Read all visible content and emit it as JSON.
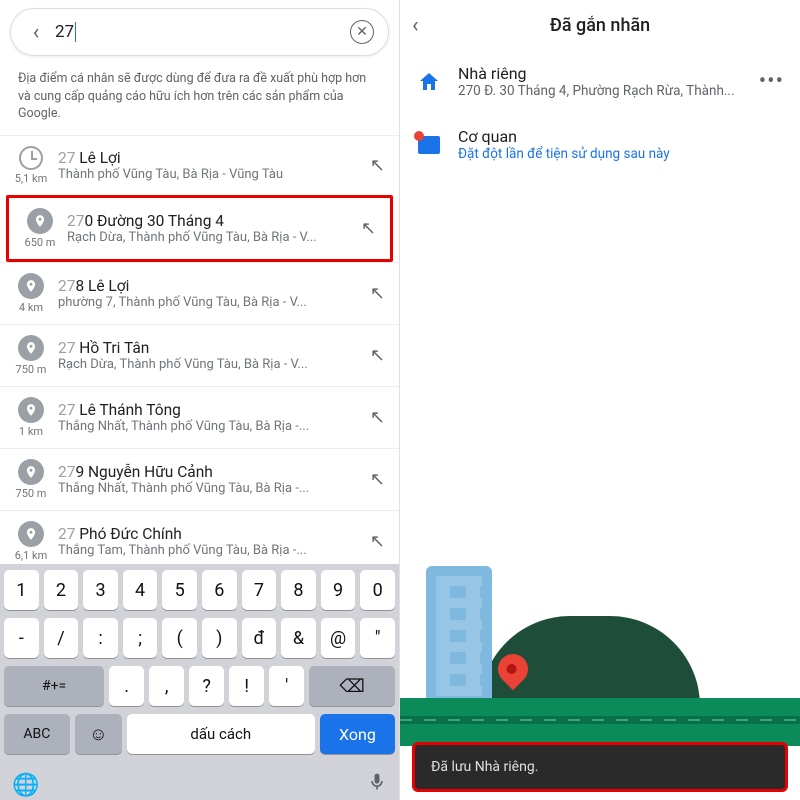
{
  "left": {
    "search_value": "27",
    "note": "Địa điểm cá nhân sẽ được dùng để đưa ra đề xuất phù hợp hơn và cung cấp quảng cáo hữu ích hơn trên các sản phẩm của Google.",
    "results": [
      {
        "icon": "clock",
        "distance": "5,1 km",
        "match": "27",
        "rest": " Lê Lợi",
        "sub": "Thành phố Vũng Tàu, Bà Rịa - Vũng Tàu",
        "highlight": false
      },
      {
        "icon": "pin",
        "distance": "650 m",
        "match": "27",
        "rest": "0 Đường 30 Tháng 4",
        "sub": "Rạch Dừa, Thành phố Vũng Tàu, Bà Rịa - V...",
        "highlight": true
      },
      {
        "icon": "pin",
        "distance": "4 km",
        "match": "27",
        "rest": "8 Lê Lợi",
        "sub": "phường 7, Thành phố Vũng Tàu, Bà Rịa - V...",
        "highlight": false
      },
      {
        "icon": "pin",
        "distance": "750 m",
        "match": "27",
        "rest": " Hồ Tri Tân",
        "sub": "Rạch Dừa, Thành phố Vũng Tàu, Bà Rịa - V...",
        "highlight": false
      },
      {
        "icon": "pin",
        "distance": "1 km",
        "match": "27",
        "rest": " Lê Thánh Tông",
        "sub": "Thắng Nhất, Thành phố Vũng Tàu, Bà Rịa -...",
        "highlight": false
      },
      {
        "icon": "pin",
        "distance": "750 m",
        "match": "27",
        "rest": "9 Nguyễn Hữu Cảnh",
        "sub": "Thắng Nhất, Thành phố Vũng Tàu, Bà Rịa -...",
        "highlight": false
      },
      {
        "icon": "pin",
        "distance": "6,1 km",
        "match": "27",
        "rest": " Phó Đức Chính",
        "sub": "Thắng Tam, Thành phố Vũng Tàu, Bà Rịa -...",
        "highlight": false
      }
    ],
    "keyboard": {
      "row1": [
        "1",
        "2",
        "3",
        "4",
        "5",
        "6",
        "7",
        "8",
        "9",
        "0"
      ],
      "row2": [
        "-",
        "/",
        ":",
        ";",
        "(",
        ")",
        "đ",
        "&",
        "@",
        "\""
      ],
      "row3_left": "#+=",
      "row3": [
        ".",
        ",",
        "?",
        "!",
        "'"
      ],
      "row3_bksp": "⌫",
      "row4_abc": "ABC",
      "row4_emoji": "☺",
      "row4_space": "dấu cách",
      "row4_done": "Xong",
      "bar_globe": "🌐",
      "bar_mic": "🎤"
    }
  },
  "right": {
    "title": "Đã gắn nhãn",
    "items": [
      {
        "icon": "home",
        "title": "Nhà riêng",
        "sub": "270 Đ. 30 Tháng 4, Phường Rạch Rừa, Thành...",
        "sub_link": false,
        "more": true
      },
      {
        "icon": "work",
        "title": "Cơ quan",
        "sub": "Đặt đột lần để tiện sử dụng sau này",
        "sub_link": true,
        "more": false
      }
    ],
    "toast": "Đã lưu Nhà riêng."
  }
}
